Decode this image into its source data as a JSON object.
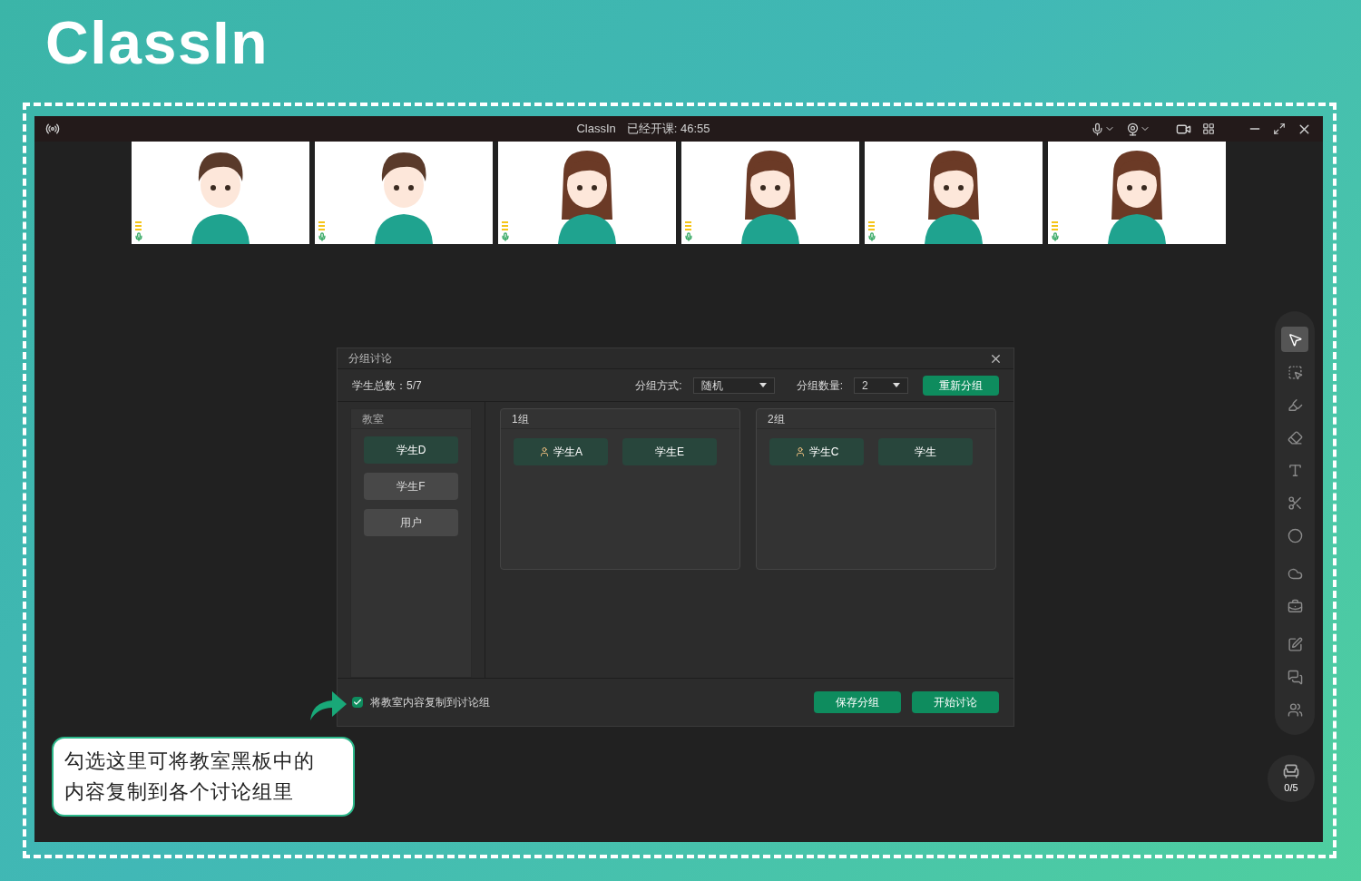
{
  "brand": {
    "logo": "ClassIn"
  },
  "titlebar": {
    "app": "ClassIn",
    "status": "已经开课: 46:55"
  },
  "video_tiles": [
    {
      "kind": "boy"
    },
    {
      "kind": "boy"
    },
    {
      "kind": "girl"
    },
    {
      "kind": "girl"
    },
    {
      "kind": "girl"
    },
    {
      "kind": "girl"
    }
  ],
  "dialog": {
    "title": "分组讨论",
    "total": "学生总数：5/7",
    "method_label": "分组方式:",
    "method_value": "随机",
    "count_label": "分组数量:",
    "count_value": "2",
    "regroup_button": "重新分组",
    "classroom": {
      "title": "教室",
      "students": [
        {
          "name": "学生D",
          "active": true
        },
        {
          "name": "学生F",
          "active": false
        },
        {
          "name": "用户",
          "active": false
        }
      ]
    },
    "groups": [
      {
        "title": "1组",
        "members": [
          {
            "name": "学生A",
            "leader": true
          },
          {
            "name": "学生E",
            "leader": false
          }
        ]
      },
      {
        "title": "2组",
        "members": [
          {
            "name": "学生C",
            "leader": true
          },
          {
            "name": "学生",
            "leader": false
          }
        ]
      }
    ],
    "copy_option": {
      "label": "将教室内容复制到讨论组",
      "checked": true
    },
    "buttons": [
      "保存分组",
      "开始讨论"
    ]
  },
  "toolbar": [
    {
      "kind": "pointer",
      "selected": true
    },
    {
      "kind": "select",
      "selected": false
    },
    {
      "kind": "laser",
      "selected": false
    },
    {
      "kind": "eraser",
      "selected": false
    },
    {
      "kind": "text",
      "selected": false
    },
    {
      "kind": "scissors",
      "selected": false
    },
    {
      "kind": "shape",
      "selected": false
    },
    {
      "kind": "cloud",
      "selected": false
    },
    {
      "kind": "toolbox",
      "selected": false
    },
    {
      "kind": "edit",
      "selected": false
    },
    {
      "kind": "chat",
      "selected": false
    },
    {
      "kind": "users",
      "selected": false
    }
  ],
  "seats": {
    "count": "0/5"
  },
  "callout": {
    "lines": [
      "勾选这里可将教室黑板中的",
      "内容复制到各个讨论组里"
    ]
  }
}
